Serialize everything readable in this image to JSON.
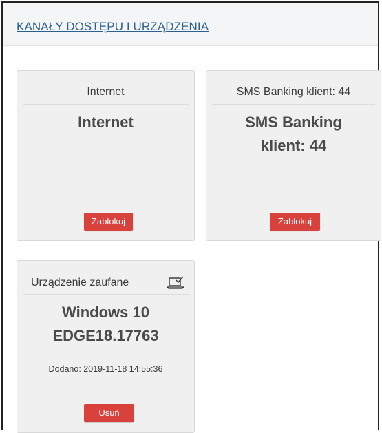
{
  "section": {
    "title": "KANAŁY DOSTĘPU I URZĄDZENIA"
  },
  "cards": [
    {
      "header": "Internet",
      "title_lines": [
        "Internet"
      ],
      "button_label": "Zablokuj"
    },
    {
      "header": "SMS Banking klient: 44",
      "title_lines": [
        "SMS Banking",
        "klient: 44"
      ],
      "button_label": "Zablokuj"
    }
  ],
  "device": {
    "header": "Urządzenie zaufane",
    "icon": "laptop-check-icon",
    "title_lines": [
      "Windows 10",
      "EDGE18.17763"
    ],
    "added": "Dodano: 2019-11-18 14:55:36",
    "button_label": "Usuń"
  },
  "colors": {
    "link": "#2a5f8f",
    "danger_button": "#d9413d",
    "card_background": "#f0f0f0"
  }
}
